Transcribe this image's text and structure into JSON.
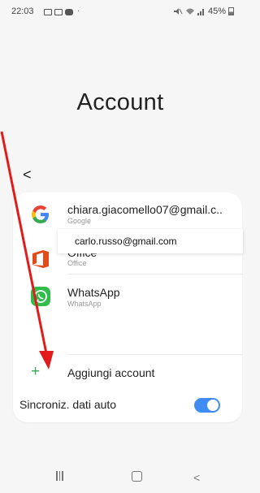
{
  "status_bar": {
    "time": "22:03",
    "battery": "45%"
  },
  "header": {
    "title": "Account",
    "back": "<"
  },
  "accounts": [
    {
      "title": "chiara.giacomello07@gmail.c..",
      "subtitle": "Google",
      "icon": "google-icon"
    },
    {
      "title": "Office",
      "subtitle": "Office",
      "icon": "office-icon"
    },
    {
      "title": "WhatsApp",
      "subtitle": "WhatsApp",
      "icon": "whatsapp-icon"
    }
  ],
  "popup_text": "carlo.russo@gmail.com",
  "add_account": {
    "plus": "+",
    "label": "Aggiungi account"
  },
  "sync": {
    "label": "Sincroniz. dati auto",
    "enabled": true
  },
  "nav": {
    "back": "<"
  },
  "colors": {
    "accent": "#3f8cf5",
    "annotation_arrow": "#e21b1b",
    "add_green": "#3aa657"
  }
}
